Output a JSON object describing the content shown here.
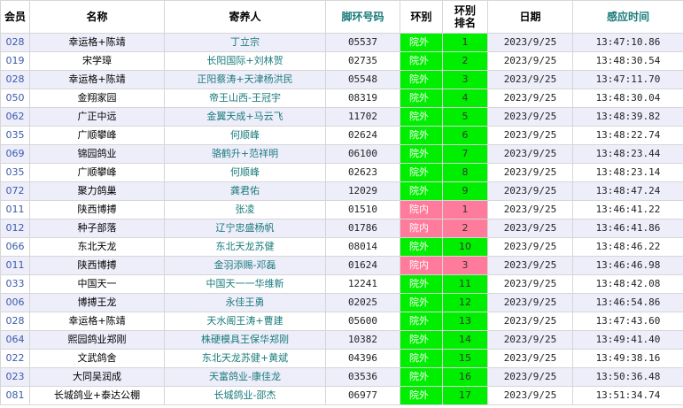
{
  "headers": {
    "member": "会员",
    "name": "名称",
    "owner": "寄养人",
    "ring": "脚环号码",
    "category": "环别",
    "rank": "环别\n排名",
    "date": "日期",
    "time": "感应时间"
  },
  "colors": {
    "outside": "#00ee00",
    "inside": "#ff7b9c",
    "link": "#1a7a7a",
    "member": "#3a5aa8"
  },
  "rows": [
    {
      "member": "028",
      "name": "幸运格+陈靖",
      "owner": "丁立宗",
      "ring": "05537",
      "category": "院外",
      "cat_type": "out",
      "rank": "1",
      "date": "2023/9/25",
      "time": "13:47:10.86"
    },
    {
      "member": "019",
      "name": "宋学璋",
      "owner": "长阳国际+刘林贺",
      "ring": "02735",
      "category": "院外",
      "cat_type": "out",
      "rank": "2",
      "date": "2023/9/25",
      "time": "13:48:30.54"
    },
    {
      "member": "028",
      "name": "幸运格+陈靖",
      "owner": "正阳蔡涛+天津杨洪民",
      "ring": "05548",
      "category": "院外",
      "cat_type": "out",
      "rank": "3",
      "date": "2023/9/25",
      "time": "13:47:11.70"
    },
    {
      "member": "050",
      "name": "金翔家园",
      "owner": "帝王山西-王冠宇",
      "ring": "08319",
      "category": "院外",
      "cat_type": "out",
      "rank": "4",
      "date": "2023/9/25",
      "time": "13:48:30.04"
    },
    {
      "member": "062",
      "name": "广正中远",
      "owner": "金翼天成+马云飞",
      "ring": "11702",
      "category": "院外",
      "cat_type": "out",
      "rank": "5",
      "date": "2023/9/25",
      "time": "13:48:39.82"
    },
    {
      "member": "035",
      "name": "广顺攀峰",
      "owner": "何顺峰",
      "ring": "02624",
      "category": "院外",
      "cat_type": "out",
      "rank": "6",
      "date": "2023/9/25",
      "time": "13:48:22.74"
    },
    {
      "member": "069",
      "name": "锦园鸽业",
      "owner": "骆鹤升+范祥明",
      "ring": "06100",
      "category": "院外",
      "cat_type": "out",
      "rank": "7",
      "date": "2023/9/25",
      "time": "13:48:23.44"
    },
    {
      "member": "035",
      "name": "广顺攀峰",
      "owner": "何顺峰",
      "ring": "02623",
      "category": "院外",
      "cat_type": "out",
      "rank": "8",
      "date": "2023/9/25",
      "time": "13:48:23.14"
    },
    {
      "member": "072",
      "name": "聚力鸽巢",
      "owner": "龚君佑",
      "ring": "12029",
      "category": "院外",
      "cat_type": "out",
      "rank": "9",
      "date": "2023/9/25",
      "time": "13:48:47.24"
    },
    {
      "member": "011",
      "name": "陕西博搏",
      "owner": "张凌",
      "ring": "01510",
      "category": "院内",
      "cat_type": "in",
      "rank": "1",
      "date": "2023/9/25",
      "time": "13:46:41.22"
    },
    {
      "member": "012",
      "name": "种子部落",
      "owner": "辽宁忠盛杨帆",
      "ring": "01786",
      "category": "院内",
      "cat_type": "in",
      "rank": "2",
      "date": "2023/9/25",
      "time": "13:46:41.86"
    },
    {
      "member": "066",
      "name": "东北天龙",
      "owner": "东北天龙苏健",
      "ring": "08014",
      "category": "院外",
      "cat_type": "out",
      "rank": "10",
      "date": "2023/9/25",
      "time": "13:48:46.22"
    },
    {
      "member": "011",
      "name": "陕西博搏",
      "owner": "金羽添赐-邓磊",
      "ring": "01624",
      "category": "院内",
      "cat_type": "in",
      "rank": "3",
      "date": "2023/9/25",
      "time": "13:46:46.98"
    },
    {
      "member": "033",
      "name": "中国天一",
      "owner": "中国天一一华维新",
      "ring": "12241",
      "category": "院外",
      "cat_type": "out",
      "rank": "11",
      "date": "2023/9/25",
      "time": "13:48:42.08"
    },
    {
      "member": "006",
      "name": "博搏王龙",
      "owner": "永佳王勇",
      "ring": "02025",
      "category": "院外",
      "cat_type": "out",
      "rank": "12",
      "date": "2023/9/25",
      "time": "13:46:54.86"
    },
    {
      "member": "028",
      "name": "幸运格+陈靖",
      "owner": "天水阁王涛+曹建",
      "ring": "05600",
      "category": "院外",
      "cat_type": "out",
      "rank": "13",
      "date": "2023/9/25",
      "time": "13:47:43.60"
    },
    {
      "member": "064",
      "name": "熙园鸽业郑刚",
      "owner": "株硬模具王保华郑刚",
      "ring": "10382",
      "category": "院外",
      "cat_type": "out",
      "rank": "14",
      "date": "2023/9/25",
      "time": "13:49:41.40"
    },
    {
      "member": "022",
      "name": "文武鸽舍",
      "owner": "东北天龙苏健+黄斌",
      "ring": "04396",
      "category": "院外",
      "cat_type": "out",
      "rank": "15",
      "date": "2023/9/25",
      "time": "13:49:38.16"
    },
    {
      "member": "023",
      "name": "大同吴润成",
      "owner": "天富鸽业-康佳龙",
      "ring": "03536",
      "category": "院外",
      "cat_type": "out",
      "rank": "16",
      "date": "2023/9/25",
      "time": "13:50:36.48"
    },
    {
      "member": "081",
      "name": "长城鸽业+泰达公棚",
      "owner": "长城鸽业-邵杰",
      "ring": "06977",
      "category": "院外",
      "cat_type": "out",
      "rank": "17",
      "date": "2023/9/25",
      "time": "13:51:34.74"
    }
  ]
}
